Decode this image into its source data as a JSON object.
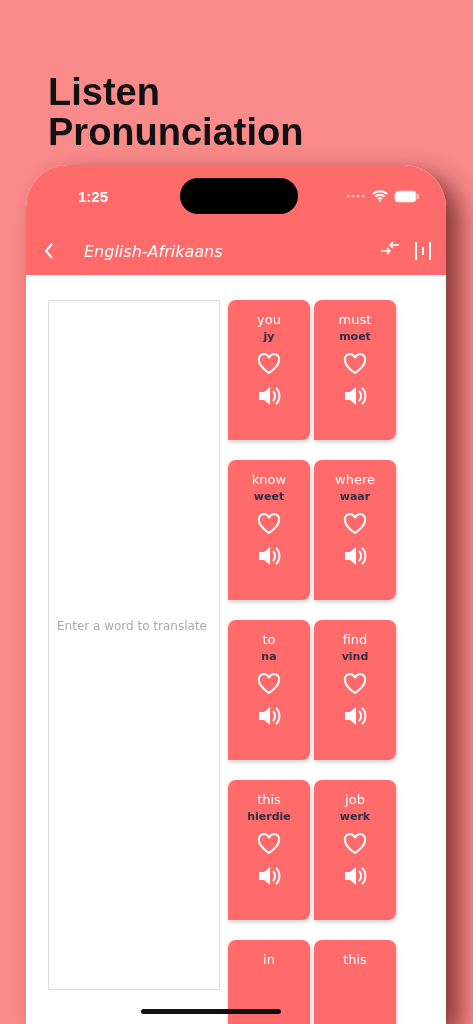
{
  "headline": "Listen\nPronunciation",
  "status_bar": {
    "time": "1:25"
  },
  "nav": {
    "title": "English-Afrikaans"
  },
  "input": {
    "placeholder": "Enter a word to translate"
  },
  "cards": [
    {
      "english": "you",
      "afrikaans": "jy"
    },
    {
      "english": "must",
      "afrikaans": "moet"
    },
    {
      "english": "know",
      "afrikaans": "weet"
    },
    {
      "english": "where",
      "afrikaans": "waar"
    },
    {
      "english": "to",
      "afrikaans": "na"
    },
    {
      "english": "find",
      "afrikaans": "vind"
    },
    {
      "english": "this",
      "afrikaans": "hierdie"
    },
    {
      "english": "job",
      "afrikaans": "werk"
    },
    {
      "english": "in"
    },
    {
      "english": "this"
    }
  ]
}
